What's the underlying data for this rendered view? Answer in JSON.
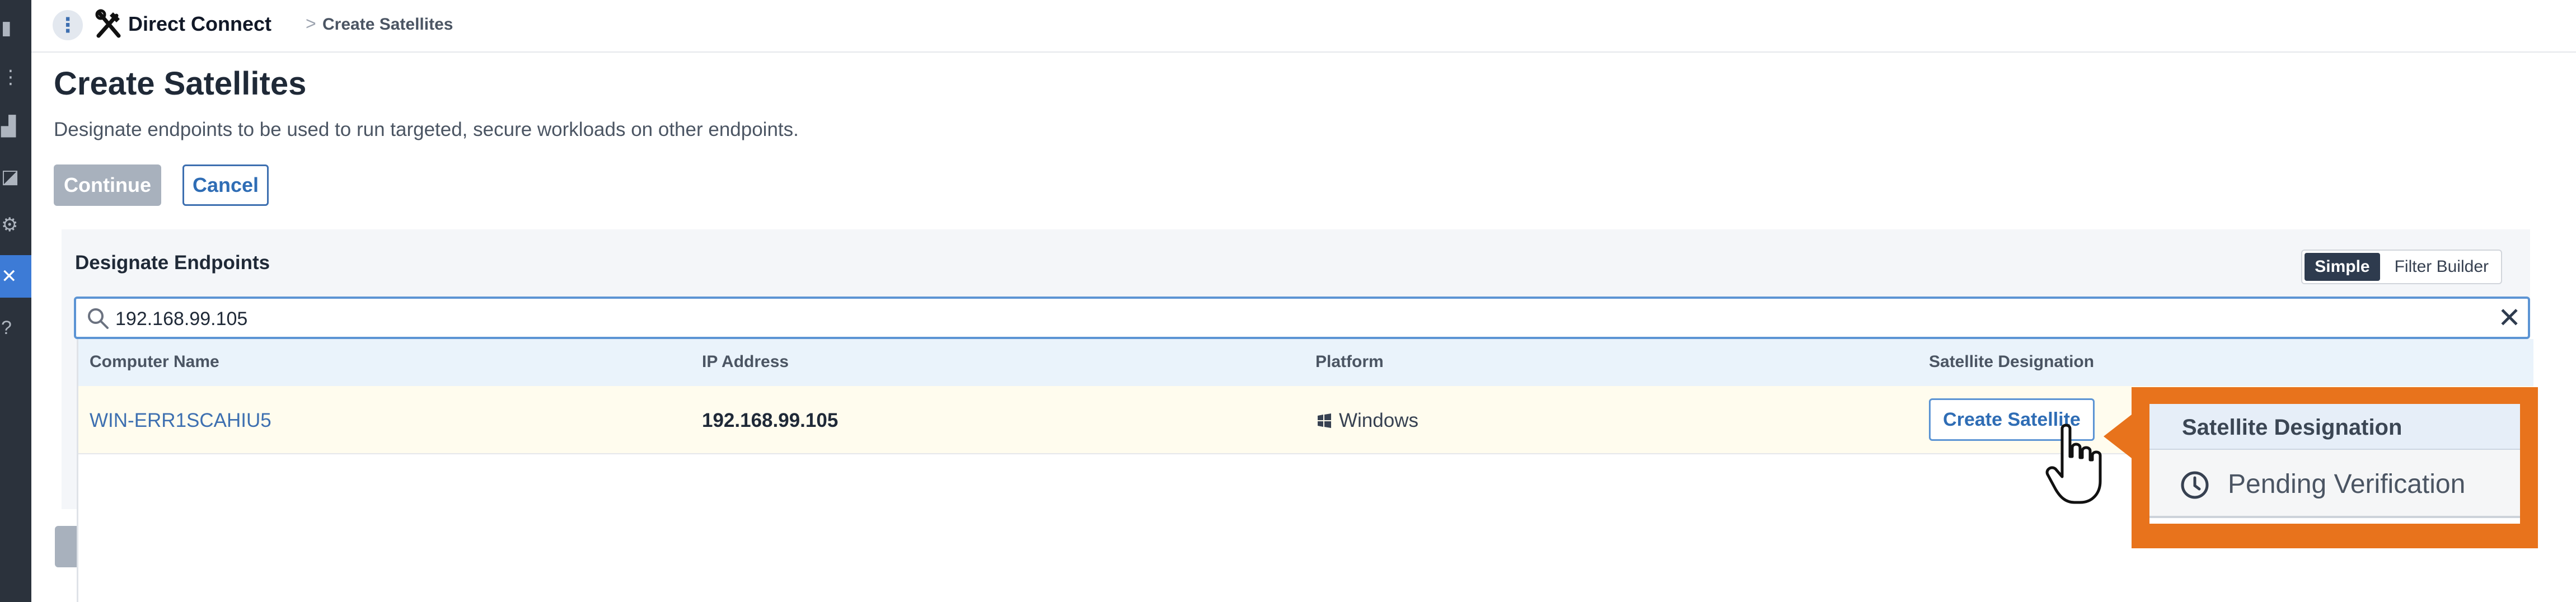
{
  "app": {
    "name": "Direct Connect"
  },
  "breadcrumb": {
    "separator": ">",
    "current": "Create Satellites"
  },
  "page": {
    "title": "Create Satellites",
    "description": "Designate endpoints to be used to run targeted, secure workloads on other endpoints."
  },
  "actions": {
    "continue_label": "Continue",
    "cancel_label": "Cancel"
  },
  "panel": {
    "title": "Designate Endpoints",
    "toggle": {
      "simple": "Simple",
      "filter_builder": "Filter Builder",
      "selected": "Simple"
    }
  },
  "search": {
    "value": "192.168.99.105"
  },
  "table": {
    "headers": {
      "computer_name": "Computer Name",
      "ip_address": "IP Address",
      "platform": "Platform",
      "satellite_designation": "Satellite Designation"
    },
    "rows": [
      {
        "computer_name": "WIN-ERR1SCAHIU5",
        "ip_address": "192.168.99.105",
        "platform": "Windows",
        "action_label": "Create Satellite"
      }
    ]
  },
  "callout": {
    "title": "Satellite Designation",
    "status": "Pending Verification"
  },
  "colors": {
    "accent": "#3d6fb0",
    "callout": "#e8731c",
    "sidebar": "#2b323c",
    "row_highlight": "#fffcee"
  },
  "icons": [
    "menu-icon",
    "tools-icon",
    "search-icon",
    "close-icon",
    "windows-icon",
    "clock-icon",
    "hand-cursor-icon"
  ]
}
